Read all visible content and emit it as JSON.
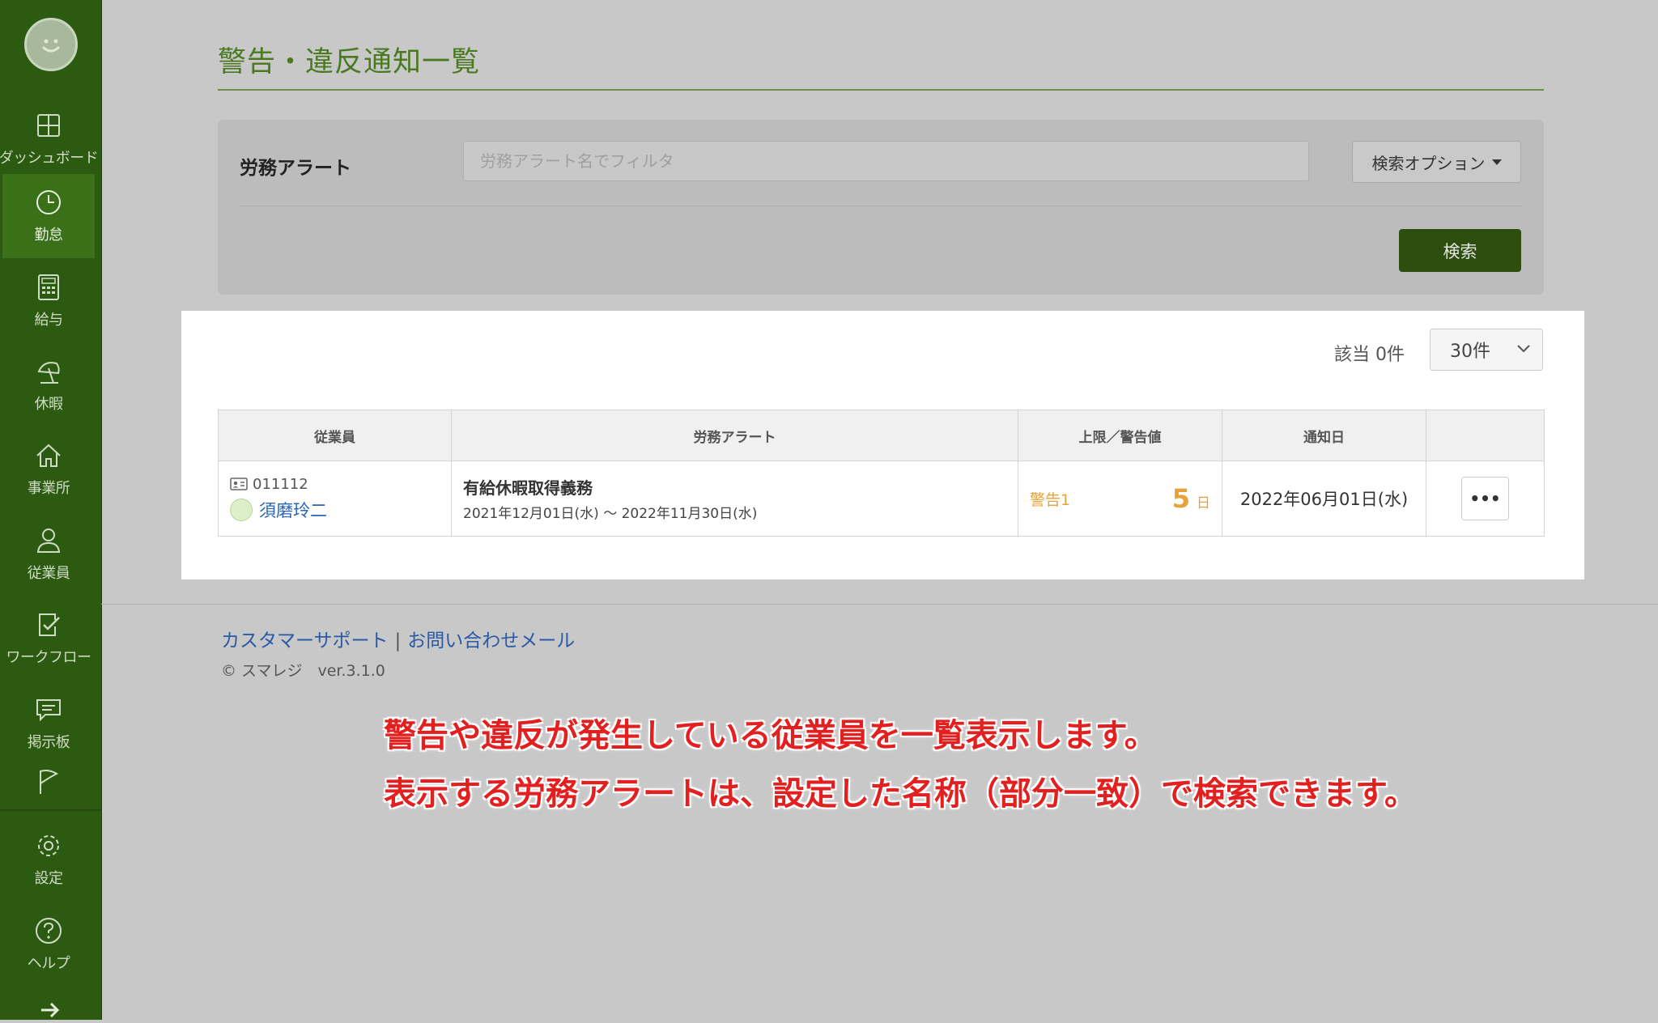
{
  "sidebar": {
    "items": [
      {
        "label": "ダッシュボード",
        "icon": "dashboard-icon"
      },
      {
        "label": "勤怠",
        "icon": "clock-icon"
      },
      {
        "label": "給与",
        "icon": "calculator-icon"
      },
      {
        "label": "休暇",
        "icon": "beach-umbrella-icon"
      },
      {
        "label": "事業所",
        "icon": "home-icon"
      },
      {
        "label": "従業員",
        "icon": "person-icon"
      },
      {
        "label": "ワークフロー",
        "icon": "clipboard-check-icon"
      },
      {
        "label": "掲示板",
        "icon": "chat-bubble-icon"
      },
      {
        "label": "設定",
        "icon": "gear-icon"
      },
      {
        "label": "ヘルプ",
        "icon": "question-icon"
      }
    ],
    "active_index": 1
  },
  "page": {
    "title": "警告・違反通知一覧"
  },
  "filter": {
    "label": "労務アラート",
    "placeholder": "労務アラート名でフィルタ",
    "value": "",
    "options_label": "検索オプション",
    "search_label": "検索"
  },
  "results": {
    "count_label": "該当 0件",
    "per_page": "30件",
    "columns": [
      "従業員",
      "労務アラート",
      "上限／警告値",
      "通知日",
      ""
    ],
    "rows": [
      {
        "employee_code": "011112",
        "employee_name": "須磨玲二",
        "alert_name": "有給休暇取得義務",
        "alert_period": "2021年12月01日(水) 〜 2022年11月30日(水)",
        "level_label": "警告1",
        "limit_value": "5",
        "limit_unit": "日",
        "notify_date": "2022年06月01日(水)",
        "menu_label": "•••"
      }
    ]
  },
  "footer": {
    "support_link": "カスタマーサポート",
    "separator": "|",
    "mail_link": "お問い合わせメール",
    "copyright": "© スマレジ　ver.3.1.0"
  },
  "annotation": {
    "line1": "警告や違反が発生している従業員を一覧表示します。",
    "line2": "表示する労務アラートは、設定した名称（部分一致）で検索できます。"
  },
  "colors": {
    "sidebar": "#2c5a10",
    "title": "#4a7a1f",
    "primary_button": "#2d4e0f",
    "warning": "#e8a23a",
    "annotation": "#e32020",
    "link": "#2a64b4"
  }
}
